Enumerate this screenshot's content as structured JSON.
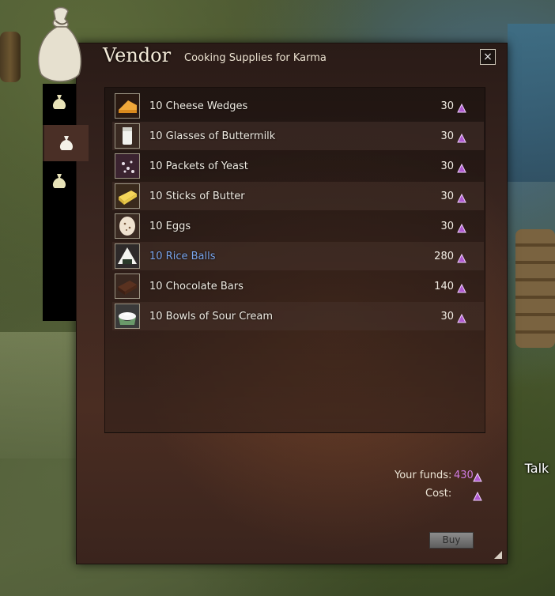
{
  "window": {
    "title": "Vendor",
    "subtitle": "Cooking Supplies for Karma",
    "close_icon": "×"
  },
  "tabs": [
    {
      "icon": "sack-icon",
      "active": false
    },
    {
      "icon": "sack-icon",
      "active": true
    },
    {
      "icon": "sack-icon",
      "active": false
    }
  ],
  "items": [
    {
      "name": "10 Cheese Wedges",
      "price": "30",
      "icon": "cheese-icon",
      "rare": false
    },
    {
      "name": "10 Glasses of Buttermilk",
      "price": "30",
      "icon": "buttermilk-icon",
      "rare": false
    },
    {
      "name": "10 Packets of Yeast",
      "price": "30",
      "icon": "yeast-icon",
      "rare": false
    },
    {
      "name": "10 Sticks of Butter",
      "price": "30",
      "icon": "butter-icon",
      "rare": false
    },
    {
      "name": "10 Eggs",
      "price": "30",
      "icon": "egg-icon",
      "rare": false
    },
    {
      "name": "10 Rice Balls",
      "price": "280",
      "icon": "rice-ball-icon",
      "rare": true
    },
    {
      "name": "10 Chocolate Bars",
      "price": "140",
      "icon": "chocolate-icon",
      "rare": false
    },
    {
      "name": "10 Bowls of Sour Cream",
      "price": "30",
      "icon": "sour-cream-icon",
      "rare": false
    }
  ],
  "footer": {
    "funds_label": "Your funds:",
    "funds_value": "430",
    "cost_label": "Cost:",
    "buy_label": "Buy"
  },
  "talk_label": "Talk",
  "colors": {
    "karma": "#b05ad0",
    "rare_item": "#7aa5ec",
    "funds_value": "#cf7ae0"
  }
}
